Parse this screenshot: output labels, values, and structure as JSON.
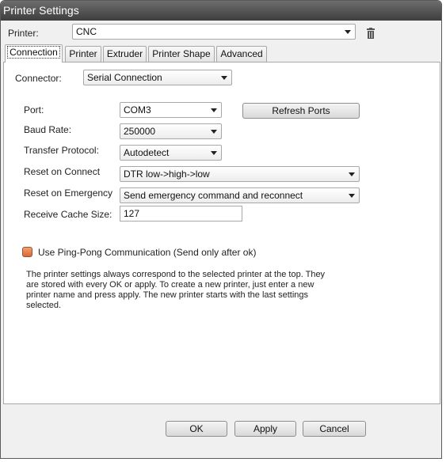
{
  "window": {
    "title": "Printer Settings"
  },
  "printer": {
    "label": "Printer:",
    "value": "CNC"
  },
  "tabs": [
    {
      "label": "Connection"
    },
    {
      "label": "Printer"
    },
    {
      "label": "Extruder"
    },
    {
      "label": "Printer Shape"
    },
    {
      "label": "Advanced"
    }
  ],
  "connection": {
    "connector_label": "Connector:",
    "connector_value": "Serial Connection",
    "port_label": "Port:",
    "port_value": "COM3",
    "refresh_label": "Refresh Ports",
    "baud_label": "Baud Rate:",
    "baud_value": "250000",
    "protocol_label": "Transfer Protocol:",
    "protocol_value": "Autodetect",
    "reset_connect_label": "Reset on Connect",
    "reset_connect_value": "DTR low->high->low",
    "reset_emergency_label": "Reset on Emergency",
    "reset_emergency_value": "Send emergency command and reconnect",
    "cache_label": "Receive Cache Size:",
    "cache_value": "127",
    "pingpong_label": "Use Ping-Pong Communication (Send only after ok)",
    "pingpong_checked": true,
    "info_text": "The printer settings always correspond to the selected printer at the top. They are stored with every OK or apply. To create a new printer, just enter a new printer name and press apply. The new printer starts with the last settings selected."
  },
  "buttons": {
    "ok": "OK",
    "apply": "Apply",
    "cancel": "Cancel"
  },
  "colors": {
    "titlebar": "#4a4a4a",
    "checkbox": "#e07040"
  }
}
